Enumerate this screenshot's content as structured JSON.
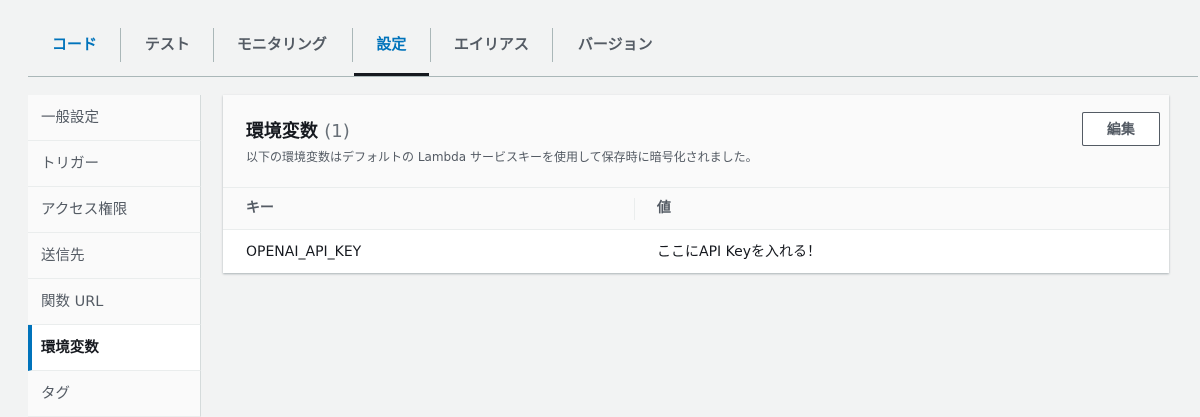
{
  "tabs": [
    {
      "label": "コード"
    },
    {
      "label": "テスト"
    },
    {
      "label": "モニタリング"
    },
    {
      "label": "設定"
    },
    {
      "label": "エイリアス"
    },
    {
      "label": "バージョン"
    }
  ],
  "sidebar": {
    "items": [
      {
        "label": "一般設定"
      },
      {
        "label": "トリガー"
      },
      {
        "label": "アクセス権限"
      },
      {
        "label": "送信先"
      },
      {
        "label": "関数 URL"
      },
      {
        "label": "環境変数"
      },
      {
        "label": "タグ"
      }
    ],
    "active_item": "環境変数"
  },
  "panel": {
    "title": "環境変数",
    "count": "(1)",
    "description": "以下の環境変数はデフォルトの Lambda サービスキーを使用して保存時に暗号化されました。",
    "edit_label": "編集",
    "table": {
      "headers": [
        "キー",
        "値"
      ],
      "rows": [
        {
          "key": "OPENAI_API_KEY",
          "value": "ここにAPI Keyを入れる！"
        }
      ]
    }
  },
  "colors": {
    "accent": "#0073bb",
    "active_tab_underline": "#16191f",
    "background": "#f2f3f3"
  }
}
